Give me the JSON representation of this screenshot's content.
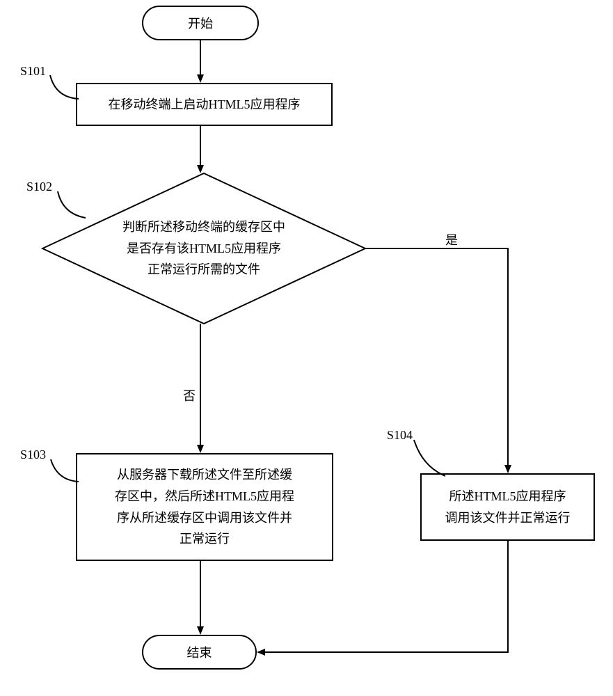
{
  "terminator": {
    "start": "开始",
    "end": "结束"
  },
  "steps": {
    "s101": "在移动终端上启动HTML5应用程序",
    "s102_l1": "判断所述移动终端的缓存区中",
    "s102_l2": "是否存有该HTML5应用程序",
    "s102_l3": "正常运行所需的文件",
    "s103_l1": "从服务器下载所述文件至所述缓",
    "s103_l2": "存区中，然后所述HTML5应用程",
    "s103_l3": "序从所述缓存区中调用该文件并",
    "s103_l4": "正常运行",
    "s104_l1": "所述HTML5应用程序",
    "s104_l2": "调用该文件并正常运行"
  },
  "labels": {
    "s101": "S101",
    "s102": "S102",
    "s103": "S103",
    "s104": "S104",
    "yes": "是",
    "no": "否"
  }
}
